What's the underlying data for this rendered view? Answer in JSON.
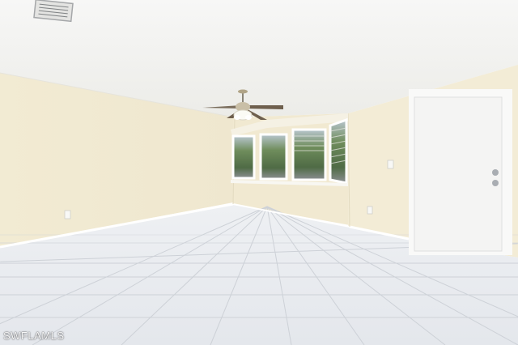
{
  "photo": {
    "subject": "empty-room",
    "colors": {
      "wall": "#f3ecd6",
      "wall_shadow": "#e8e0c6",
      "ceiling": "#f4f4f2",
      "floor": "#e9ecf0",
      "tile_grout": "#c8ccd2",
      "door": "#f6f6f5",
      "trim": "#f7f7f4",
      "window_glass": "#6d8a5b"
    },
    "icons": {
      "fan": "ceiling-fan-icon",
      "vent": "air-vent-icon",
      "door_knob": "door-knob-icon"
    }
  },
  "watermark": {
    "text": "SWFLAMLS"
  }
}
